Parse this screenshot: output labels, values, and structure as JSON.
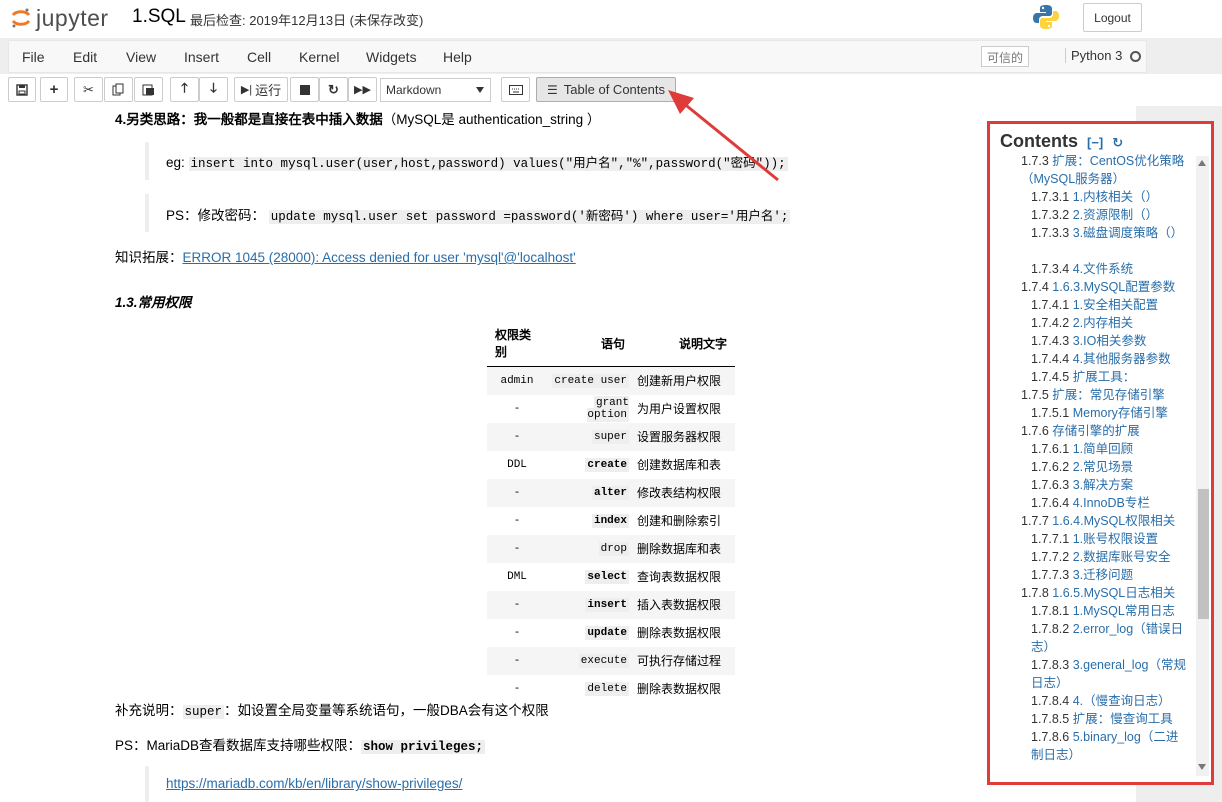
{
  "header": {
    "logo_text": "jupyter",
    "notebook_name": "1.SQL",
    "checkpoint": "最后检查: 2019年12月13日   (未保存改变)",
    "logout_label": "Logout"
  },
  "menubar": {
    "items": [
      "File",
      "Edit",
      "View",
      "Insert",
      "Cell",
      "Kernel",
      "Widgets",
      "Help"
    ],
    "trusted": "可信的",
    "kernel": "Python 3"
  },
  "toolbar": {
    "run_label": "运行",
    "cell_type": "Markdown",
    "toc_label": "Table of Contents"
  },
  "content": {
    "heading4": "4.另类思路：我一般都是直接在表中插入数据",
    "heading4_note": "（MySQL是 authentication_string ）",
    "eg_label": "eg:",
    "eg_code": "insert into mysql.user(user,host,password) values(\"用户名\",\"%\",password(\"密码\"));",
    "ps_label": "PS：修改密码：",
    "ps_code": "update mysql.user set password =password('新密码') where user='用户名';",
    "kb_label": "知识拓展：",
    "kb_link": "ERROR 1045 (28000): Access denied for user 'mysql'@'localhost'",
    "section_title": "1.3.常用权限",
    "supp_label": "补充说明：",
    "supp_code": "super",
    "supp_text": "：如设置全局变量等系统语句，一般DBA会有这个权限",
    "ps2_label": "PS：MariaDB查看数据库支持哪些权限：",
    "ps2_code": "show privileges;",
    "maria_link": "https://mariadb.com/kb/en/library/show-privileges/"
  },
  "table": {
    "headers": [
      "权限类别",
      "语句",
      "说明文字"
    ],
    "rows": [
      [
        "admin",
        "create user",
        "创建新用户权限"
      ],
      [
        "-",
        "grant option",
        "为用户设置权限"
      ],
      [
        "-",
        "super",
        "设置服务器权限"
      ],
      [
        "DDL",
        "create",
        "创建数据库和表"
      ],
      [
        "-",
        "alter",
        "修改表结构权限"
      ],
      [
        "-",
        "index",
        "创建和删除索引"
      ],
      [
        "-",
        "drop",
        "删除数据库和表"
      ],
      [
        "DML",
        "select",
        "查询表数据权限"
      ],
      [
        "-",
        "insert",
        "插入表数据权限"
      ],
      [
        "-",
        "update",
        "删除表数据权限"
      ],
      [
        "-",
        "execute",
        "可执行存储过程"
      ],
      [
        "-",
        "delete",
        "删除表数据权限"
      ]
    ],
    "bold_rows": [
      3,
      4,
      5,
      7,
      8,
      9
    ]
  },
  "toc": {
    "title": "Contents",
    "collapse": "[−]",
    "refresh": "↻",
    "items": [
      {
        "num": "1.7.3",
        "text": "扩展：CentOS优化策略（MySQL服务器）",
        "level": 1,
        "lines": 2
      },
      {
        "num": "1.7.3.1",
        "text": "1.内核相关（）",
        "level": 2,
        "lines": 1
      },
      {
        "num": "1.7.3.2",
        "text": "2.资源限制（）",
        "level": 2,
        "lines": 1
      },
      {
        "num": "1.7.3.3",
        "text": "3.磁盘调度策略（）",
        "level": 2,
        "lines": 2
      },
      {
        "num": "1.7.3.4",
        "text": "4.文件系统",
        "level": 2,
        "lines": 1
      },
      {
        "num": "1.7.4",
        "text": "1.6.3.MySQL配置参数",
        "level": 1,
        "lines": 1
      },
      {
        "num": "1.7.4.1",
        "text": "1.安全相关配置",
        "level": 2,
        "lines": 1
      },
      {
        "num": "1.7.4.2",
        "text": "2.内存相关",
        "level": 2,
        "lines": 1
      },
      {
        "num": "1.7.4.3",
        "text": "3.IO相关参数",
        "level": 2,
        "lines": 1
      },
      {
        "num": "1.7.4.4",
        "text": "4.其他服务器参数",
        "level": 2,
        "lines": 1
      },
      {
        "num": "1.7.4.5",
        "text": "扩展工具：",
        "level": 2,
        "lines": 1
      },
      {
        "num": "1.7.5",
        "text": "扩展：常见存储引擎",
        "level": 1,
        "lines": 1
      },
      {
        "num": "1.7.5.1",
        "text": "Memory存储引擎",
        "level": 2,
        "lines": 1
      },
      {
        "num": "1.7.6",
        "text": "存储引擎的扩展",
        "level": 1,
        "lines": 1
      },
      {
        "num": "1.7.6.1",
        "text": "1.简单回顾",
        "level": 2,
        "lines": 1
      },
      {
        "num": "1.7.6.2",
        "text": "2.常见场景",
        "level": 2,
        "lines": 1
      },
      {
        "num": "1.7.6.3",
        "text": "3.解决方案",
        "level": 2,
        "lines": 1
      },
      {
        "num": "1.7.6.4",
        "text": "4.InnoDB专栏",
        "level": 2,
        "lines": 1
      },
      {
        "num": "1.7.7",
        "text": "1.6.4.MySQL权限相关",
        "level": 1,
        "lines": 1
      },
      {
        "num": "1.7.7.1",
        "text": "1.账号权限设置",
        "level": 2,
        "lines": 1
      },
      {
        "num": "1.7.7.2",
        "text": "2.数据库账号安全",
        "level": 2,
        "lines": 1
      },
      {
        "num": "1.7.7.3",
        "text": "3.迁移问题",
        "level": 2,
        "lines": 1
      },
      {
        "num": "1.7.8",
        "text": "1.6.5.MySQL日志相关",
        "level": 1,
        "lines": 1
      },
      {
        "num": "1.7.8.1",
        "text": "1.MySQL常用日志",
        "level": 2,
        "lines": 1
      },
      {
        "num": "1.7.8.2",
        "text": "2.error_log（错误日志）",
        "level": 2,
        "lines": 2
      },
      {
        "num": "1.7.8.3",
        "text": "3.general_log（常规日志）",
        "level": 2,
        "lines": 2
      },
      {
        "num": "1.7.8.4",
        "text": "4.（慢查询日志）",
        "level": 2,
        "lines": 1
      },
      {
        "num": "1.7.8.5",
        "text": "扩展：慢查询工具",
        "level": 2,
        "lines": 1
      },
      {
        "num": "1.7.8.6",
        "text": "5.binary_log（二进制日志）",
        "level": 2,
        "lines": 2
      }
    ]
  },
  "colors": {
    "accent_link": "#296eaa",
    "annotation_red": "#e03b3b"
  }
}
